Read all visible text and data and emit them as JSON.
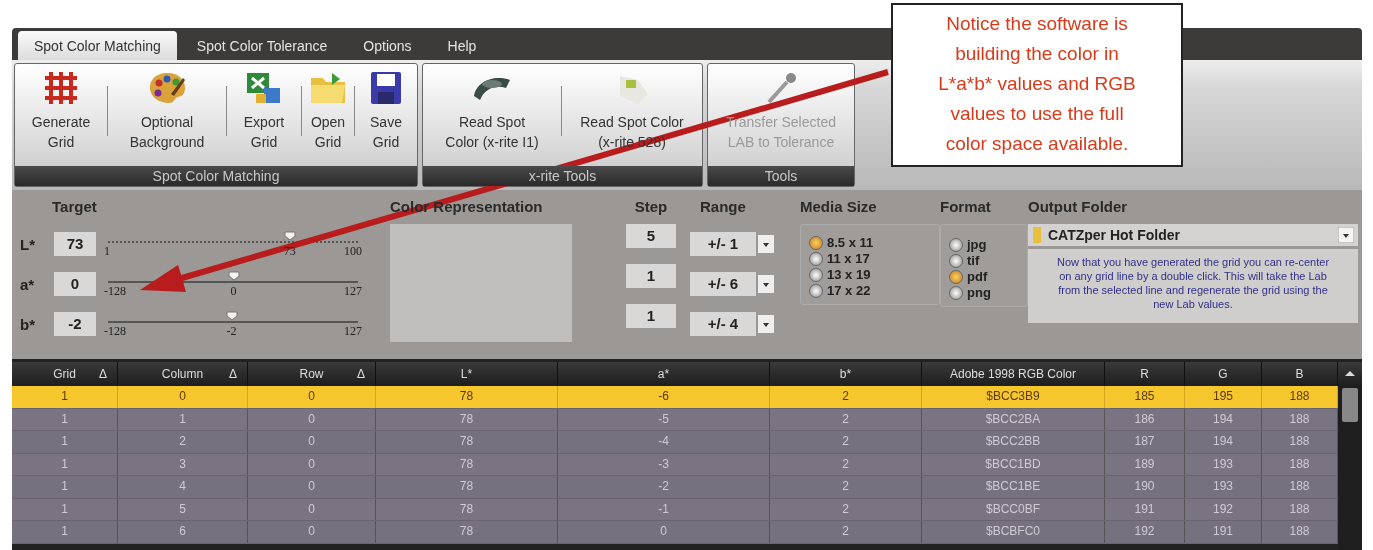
{
  "menu_tabs": [
    {
      "label": "Spot Color Matching",
      "selected": true
    },
    {
      "label": "Spot Color Tolerance",
      "selected": false
    },
    {
      "label": "Options",
      "selected": false
    },
    {
      "label": "Help",
      "selected": false
    }
  ],
  "toolbar_groups": [
    {
      "title": "Spot Color Matching",
      "buttons": [
        {
          "lines": [
            "Generate",
            "Grid"
          ],
          "disabled": false
        },
        {
          "lines": [
            "Optional",
            "Background"
          ],
          "disabled": false
        },
        {
          "lines": [
            "Export",
            "Grid"
          ],
          "disabled": false
        },
        {
          "lines": [
            "Open",
            "Grid"
          ],
          "disabled": false
        },
        {
          "lines": [
            "Save",
            "Grid"
          ],
          "disabled": false
        }
      ]
    },
    {
      "title": "x-rite Tools",
      "buttons": [
        {
          "lines": [
            "Read Spot",
            "Color (x-rite I1)"
          ],
          "disabled": false
        },
        {
          "lines": [
            "Read Spot Color",
            "(x-rite 528)"
          ],
          "disabled": false
        }
      ]
    },
    {
      "title": "Tools",
      "buttons": [
        {
          "lines": [
            "Transfer Selected",
            "LAB to Tolerance"
          ],
          "disabled": true
        }
      ]
    }
  ],
  "callout": {
    "lines": [
      "Notice the software is",
      "building the color in",
      "L*a*b* values and RGB",
      "values to use the full",
      "color space available."
    ]
  },
  "target": {
    "title": "Target",
    "channels": [
      {
        "label": "L*",
        "value": "73",
        "min": "1",
        "reading": "73",
        "max": "100",
        "level": 0.727
      },
      {
        "label": "a*",
        "value": "0",
        "min": "-128",
        "reading": "0",
        "max": "127",
        "level": 0.502
      },
      {
        "label": "b*",
        "value": "-2",
        "min": "-128",
        "reading": "-2",
        "max": "127",
        "level": 0.494
      }
    ]
  },
  "color_representation": {
    "title": "Color Representation"
  },
  "step": {
    "title": "Step",
    "values": [
      "5",
      "1",
      "1"
    ]
  },
  "range": {
    "title": "Range",
    "values": [
      "+/- 1",
      "+/- 6",
      "+/- 4"
    ]
  },
  "media_size": {
    "title": "Media Size",
    "options": [
      {
        "label": "8.5 x 11",
        "selected": true
      },
      {
        "label": "11 x 17",
        "selected": false
      },
      {
        "label": "13 x 19",
        "selected": false
      },
      {
        "label": "17 x 22",
        "selected": false
      }
    ]
  },
  "format": {
    "title": "Format",
    "options": [
      {
        "label": "jpg",
        "selected": false
      },
      {
        "label": "tif",
        "selected": false
      },
      {
        "label": "pdf",
        "selected": true
      },
      {
        "label": "png",
        "selected": false
      }
    ]
  },
  "output_folder": {
    "title": "Output Folder",
    "folder": "CATZper Hot Folder",
    "note": "Now that you have generated the grid you can re-center on any grid line by a double click. This will take the Lab from the selected line and regenerate the grid using the new Lab values."
  },
  "table": {
    "columns": [
      {
        "label": "Grid",
        "mark": "Δ"
      },
      {
        "label": "Column",
        "mark": "Δ"
      },
      {
        "label": "Row",
        "mark": "Δ"
      },
      {
        "label": "L*"
      },
      {
        "label": "a*"
      },
      {
        "label": "b*"
      },
      {
        "label": "Adobe 1998 RGB Color"
      },
      {
        "label": "R"
      },
      {
        "label": "G"
      },
      {
        "label": "B"
      }
    ],
    "rows": [
      {
        "selected": true,
        "cells": [
          "1",
          "0",
          "0",
          "78",
          "-6",
          "2",
          "$BCC3B9",
          "185",
          "195",
          "188"
        ]
      },
      {
        "selected": false,
        "cells": [
          "1",
          "1",
          "0",
          "78",
          "-5",
          "2",
          "$BCC2BA",
          "186",
          "194",
          "188"
        ]
      },
      {
        "selected": false,
        "cells": [
          "1",
          "2",
          "0",
          "78",
          "-4",
          "2",
          "$BCC2BB",
          "187",
          "194",
          "188"
        ]
      },
      {
        "selected": false,
        "cells": [
          "1",
          "3",
          "0",
          "78",
          "-3",
          "2",
          "$BCC1BD",
          "189",
          "193",
          "188"
        ]
      },
      {
        "selected": false,
        "cells": [
          "1",
          "4",
          "0",
          "78",
          "-2",
          "2",
          "$BCC1BE",
          "190",
          "193",
          "188"
        ]
      },
      {
        "selected": false,
        "cells": [
          "1",
          "5",
          "0",
          "78",
          "-1",
          "2",
          "$BCC0BF",
          "191",
          "192",
          "188"
        ]
      },
      {
        "selected": false,
        "cells": [
          "1",
          "6",
          "0",
          "78",
          "0",
          "2",
          "$BCBFC0",
          "192",
          "191",
          "188"
        ]
      }
    ]
  }
}
